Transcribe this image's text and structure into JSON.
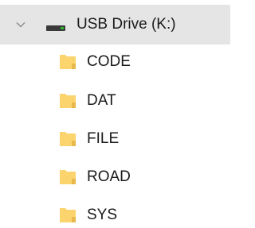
{
  "drive": {
    "label": "USB Drive (K:)",
    "expanded": true,
    "icon": "usb-drive-icon",
    "chevron_icon": "chevron-down-icon"
  },
  "folders": [
    {
      "label": "CODE",
      "icon": "folder-icon"
    },
    {
      "label": "DAT",
      "icon": "folder-icon"
    },
    {
      "label": "FILE",
      "icon": "folder-icon"
    },
    {
      "label": "ROAD",
      "icon": "folder-icon"
    },
    {
      "label": "SYS",
      "icon": "folder-icon"
    }
  ],
  "colors": {
    "selected_row": "#e5e5e5",
    "chevron": "#8a8a8a",
    "drive_body": "#3a3a3a",
    "drive_led": "#2fb52f",
    "folder_fill": "#fcd46d",
    "folder_shade": "#e8b84a",
    "text": "#1a1a1a"
  }
}
